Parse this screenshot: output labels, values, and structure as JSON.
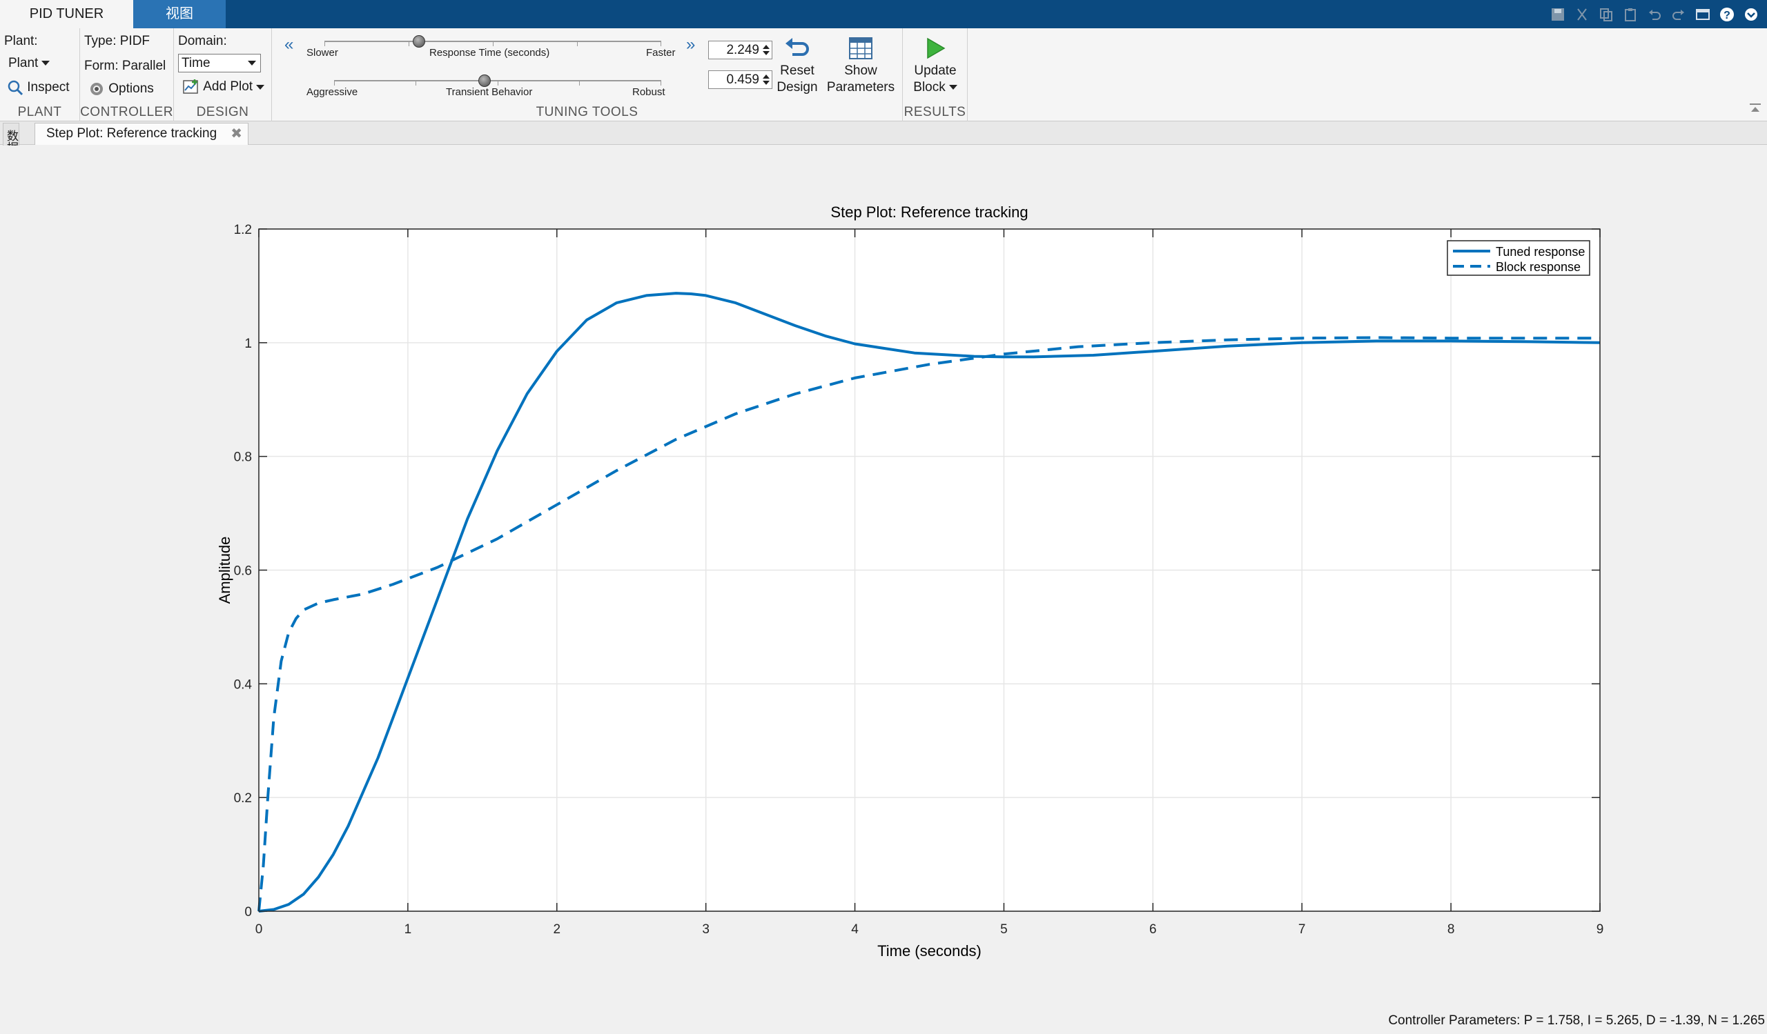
{
  "tabs": {
    "pid_tuner": "PID TUNER",
    "view": "视图"
  },
  "plant": {
    "label": "Plant:",
    "dropdown": "Plant",
    "inspect": "Inspect",
    "section": "PLANT"
  },
  "controller": {
    "type": "Type: PIDF",
    "form": "Form: Parallel",
    "options": "Options",
    "section": "CONTROLLER"
  },
  "design": {
    "domain_label": "Domain:",
    "domain_value": "Time",
    "add_plot": "Add Plot",
    "section": "DESIGN"
  },
  "tuning": {
    "rt_left": "Slower",
    "rt_center": "Response Time (seconds)",
    "rt_right": "Faster",
    "rt_value": "2.249",
    "rt_position": 0.28,
    "tb_left": "Aggressive",
    "tb_center": "Transient Behavior",
    "tb_right": "Robust",
    "tb_value": "0.459",
    "tb_position": 0.46,
    "reset": [
      "Reset",
      "Design"
    ],
    "show": [
      "Show",
      "Parameters"
    ],
    "section": "TUNING TOOLS"
  },
  "results": {
    "update": [
      "Update",
      "Block"
    ],
    "section": "RESULTS"
  },
  "document_tab": "Step Plot: Reference tracking",
  "side_browser": "数据浏览器",
  "status": "Controller Parameters: P = 1.758, I = 5.265, D = -1.39, N = 1.265",
  "colors": {
    "series": "#0072bd",
    "tab_bar": "#0b4a80",
    "active_alt_tab": "#2a73b4"
  },
  "chart_data": {
    "type": "line",
    "title": "Step Plot: Reference tracking",
    "xlabel": "Time (seconds)",
    "ylabel": "Amplitude",
    "xlim": [
      0,
      9
    ],
    "ylim": [
      0,
      1.2
    ],
    "xticks": [
      0,
      1,
      2,
      3,
      4,
      5,
      6,
      7,
      8,
      9
    ],
    "yticks": [
      0,
      0.2,
      0.4,
      0.6,
      0.8,
      1,
      1.2
    ],
    "grid": true,
    "legend": "top-right",
    "series": [
      {
        "name": "Tuned response",
        "style": "solid",
        "x": [
          0,
          0.1,
          0.2,
          0.3,
          0.4,
          0.5,
          0.6,
          0.7,
          0.8,
          0.9,
          1.0,
          1.2,
          1.4,
          1.6,
          1.8,
          2.0,
          2.2,
          2.4,
          2.6,
          2.8,
          2.9,
          3.0,
          3.2,
          3.4,
          3.6,
          3.8,
          4.0,
          4.4,
          4.8,
          5.0,
          5.2,
          5.6,
          6.0,
          6.5,
          7.0,
          7.5,
          8.0,
          8.5,
          9.0
        ],
        "y": [
          0,
          0.003,
          0.012,
          0.03,
          0.06,
          0.1,
          0.15,
          0.21,
          0.27,
          0.34,
          0.41,
          0.55,
          0.69,
          0.81,
          0.91,
          0.985,
          1.04,
          1.07,
          1.083,
          1.087,
          1.086,
          1.083,
          1.07,
          1.05,
          1.03,
          1.012,
          0.998,
          0.982,
          0.976,
          0.975,
          0.975,
          0.978,
          0.985,
          0.994,
          1.0,
          1.003,
          1.003,
          1.002,
          1.0
        ]
      },
      {
        "name": "Block response",
        "style": "dashed",
        "x": [
          0,
          0.03,
          0.06,
          0.1,
          0.15,
          0.2,
          0.25,
          0.3,
          0.4,
          0.5,
          0.7,
          0.9,
          1.0,
          1.2,
          1.4,
          1.6,
          1.8,
          2.0,
          2.4,
          2.8,
          3.2,
          3.6,
          4.0,
          4.5,
          5.0,
          5.5,
          6.0,
          6.5,
          7.0,
          7.5,
          8.0,
          8.5,
          9.0
        ],
        "y": [
          0,
          0.08,
          0.2,
          0.34,
          0.44,
          0.49,
          0.515,
          0.53,
          0.542,
          0.548,
          0.558,
          0.575,
          0.585,
          0.605,
          0.63,
          0.655,
          0.685,
          0.715,
          0.775,
          0.83,
          0.875,
          0.91,
          0.938,
          0.962,
          0.98,
          0.993,
          1.0,
          1.005,
          1.008,
          1.009,
          1.008,
          1.008,
          1.008
        ]
      }
    ]
  }
}
